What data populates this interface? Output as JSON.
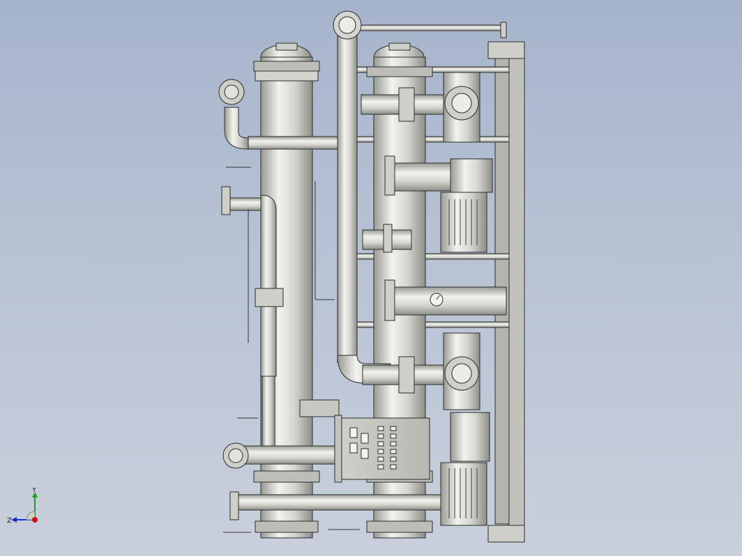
{
  "viewport": {
    "background_top": "#a6b4cb",
    "background_bottom": "#c9d0dc"
  },
  "model": {
    "metal_light": "#e9e9e4",
    "metal_mid": "#b9b9b2",
    "metal_dark": "#8c8c86",
    "outline": "#2a2a2a"
  },
  "control_panel": {
    "switch_count": 12,
    "indicator_count": 4
  },
  "triad": {
    "x_label": "",
    "y_label": "Y",
    "z_label": "Z",
    "x_color": "#d01010",
    "y_color": "#18a018",
    "z_color": "#1030d0"
  }
}
